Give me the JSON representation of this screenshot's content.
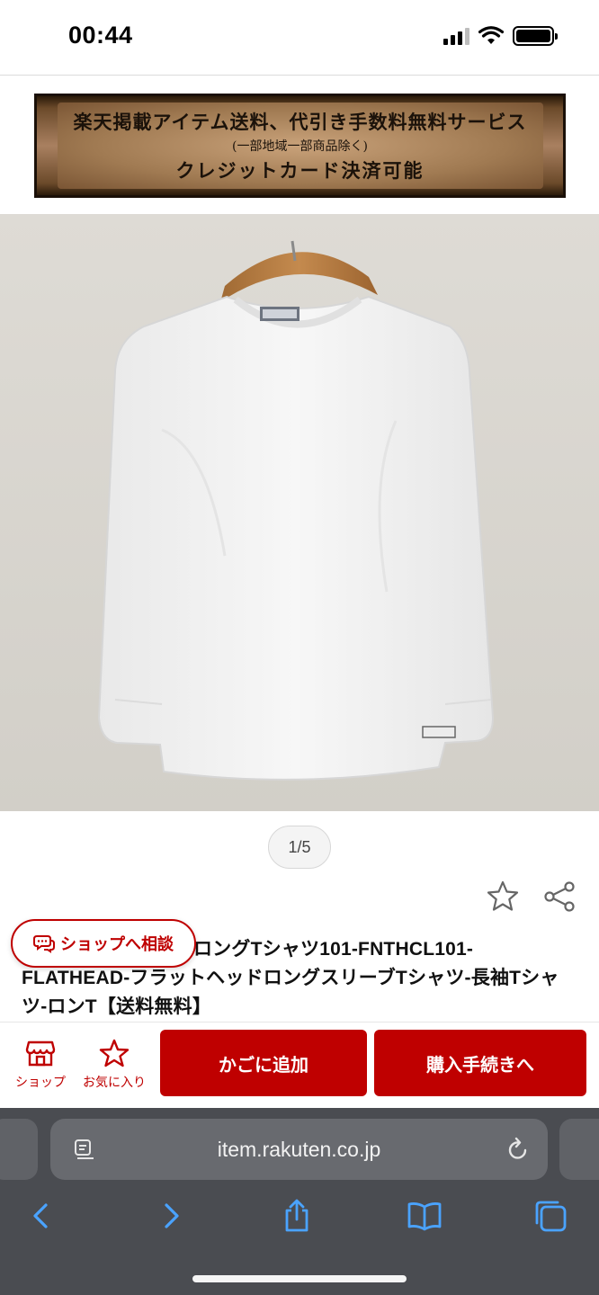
{
  "status_bar": {
    "time": "00:44"
  },
  "banner": {
    "line1": "楽天掲載アイテム送料、代引き手数料無料サービス",
    "line2": "(一部地域一部商品除く)",
    "line3": "クレジットカード決済可能"
  },
  "gallery": {
    "page_indicator": "1/5"
  },
  "product": {
    "title": "WH-フラットヘッドロングTシャツ101-FNTHCL101-FLATHEAD-フラットヘッドロングスリーブTシャツ-長袖Tシャツ-ロンT【送料無料】"
  },
  "consult_chip": {
    "label": "ショップへ相談"
  },
  "action_bar": {
    "shop_label": "ショップ",
    "favorite_label": "お気に入り",
    "add_to_cart_label": "かごに追加",
    "checkout_label": "購入手続きへ"
  },
  "browser": {
    "url": "item.rakuten.co.jp"
  },
  "colors": {
    "brand": "#bf0000",
    "toolbar_icons": "#4aa3ff"
  },
  "icons": [
    "chat-bubble-icon",
    "shop-icon",
    "star-outline-icon",
    "share-icon",
    "reader-icon",
    "reload-icon",
    "back-icon",
    "forward-icon",
    "share-sheet-icon",
    "bookmarks-icon",
    "tabs-icon"
  ]
}
